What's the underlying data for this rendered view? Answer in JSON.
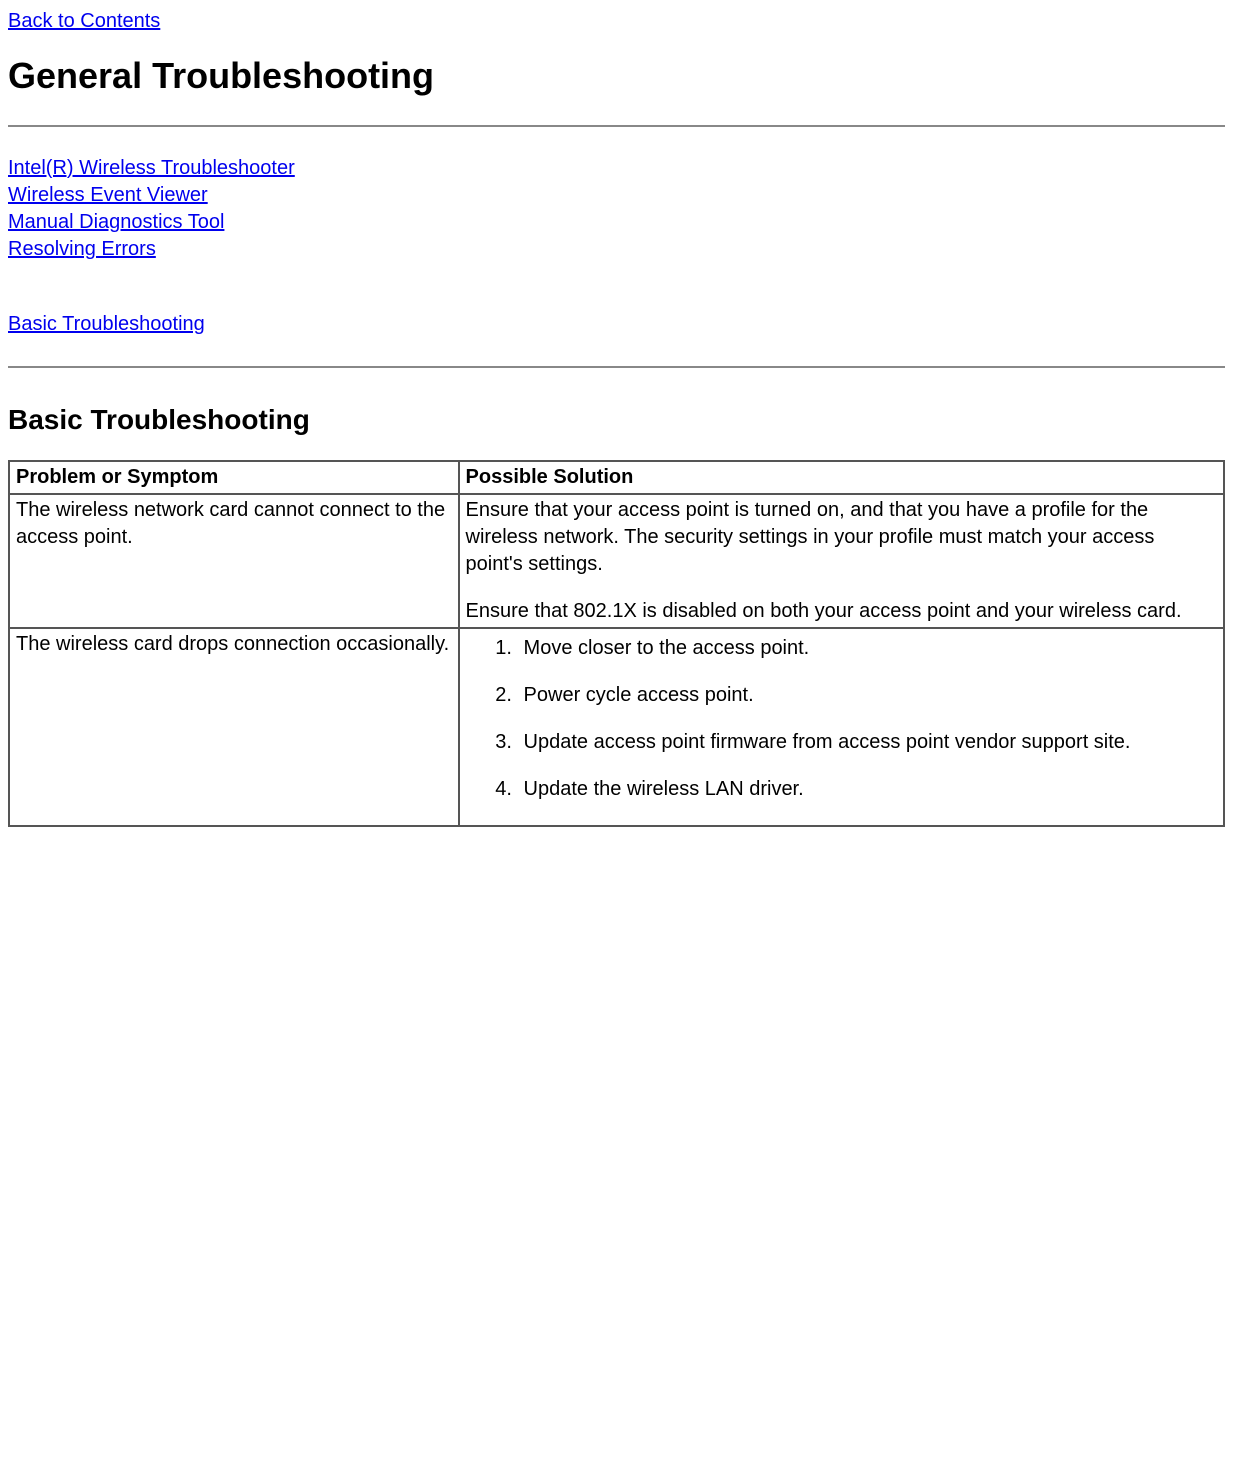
{
  "nav": {
    "back_to_contents": "Back to Contents"
  },
  "headings": {
    "main": "General Troubleshooting",
    "section": "Basic Troubleshooting"
  },
  "links": {
    "troubleshooter": "Intel(R) Wireless Troubleshooter",
    "event_viewer": "Wireless Event Viewer",
    "diagnostics": "Manual Diagnostics Tool",
    "resolving_errors": "Resolving Errors",
    "basic_troubleshooting": "Basic Troubleshooting"
  },
  "table": {
    "headers": {
      "problem": "Problem or Symptom",
      "solution": "Possible Solution"
    },
    "rows": [
      {
        "problem": "The wireless network card cannot connect to the access point.",
        "solution_p1": "Ensure that your access point is turned on, and that you have a profile for the wireless network. The security settings in your profile must match your access point's settings.",
        "solution_p2": "Ensure that 802.1X is disabled on both your access point and your wireless card."
      },
      {
        "problem": "The wireless card drops connection occasionally.",
        "steps": [
          "Move closer to the access point.",
          "Power cycle access point.",
          "Update access point firmware from access point vendor support site.",
          "Update the wireless LAN driver."
        ]
      }
    ]
  }
}
